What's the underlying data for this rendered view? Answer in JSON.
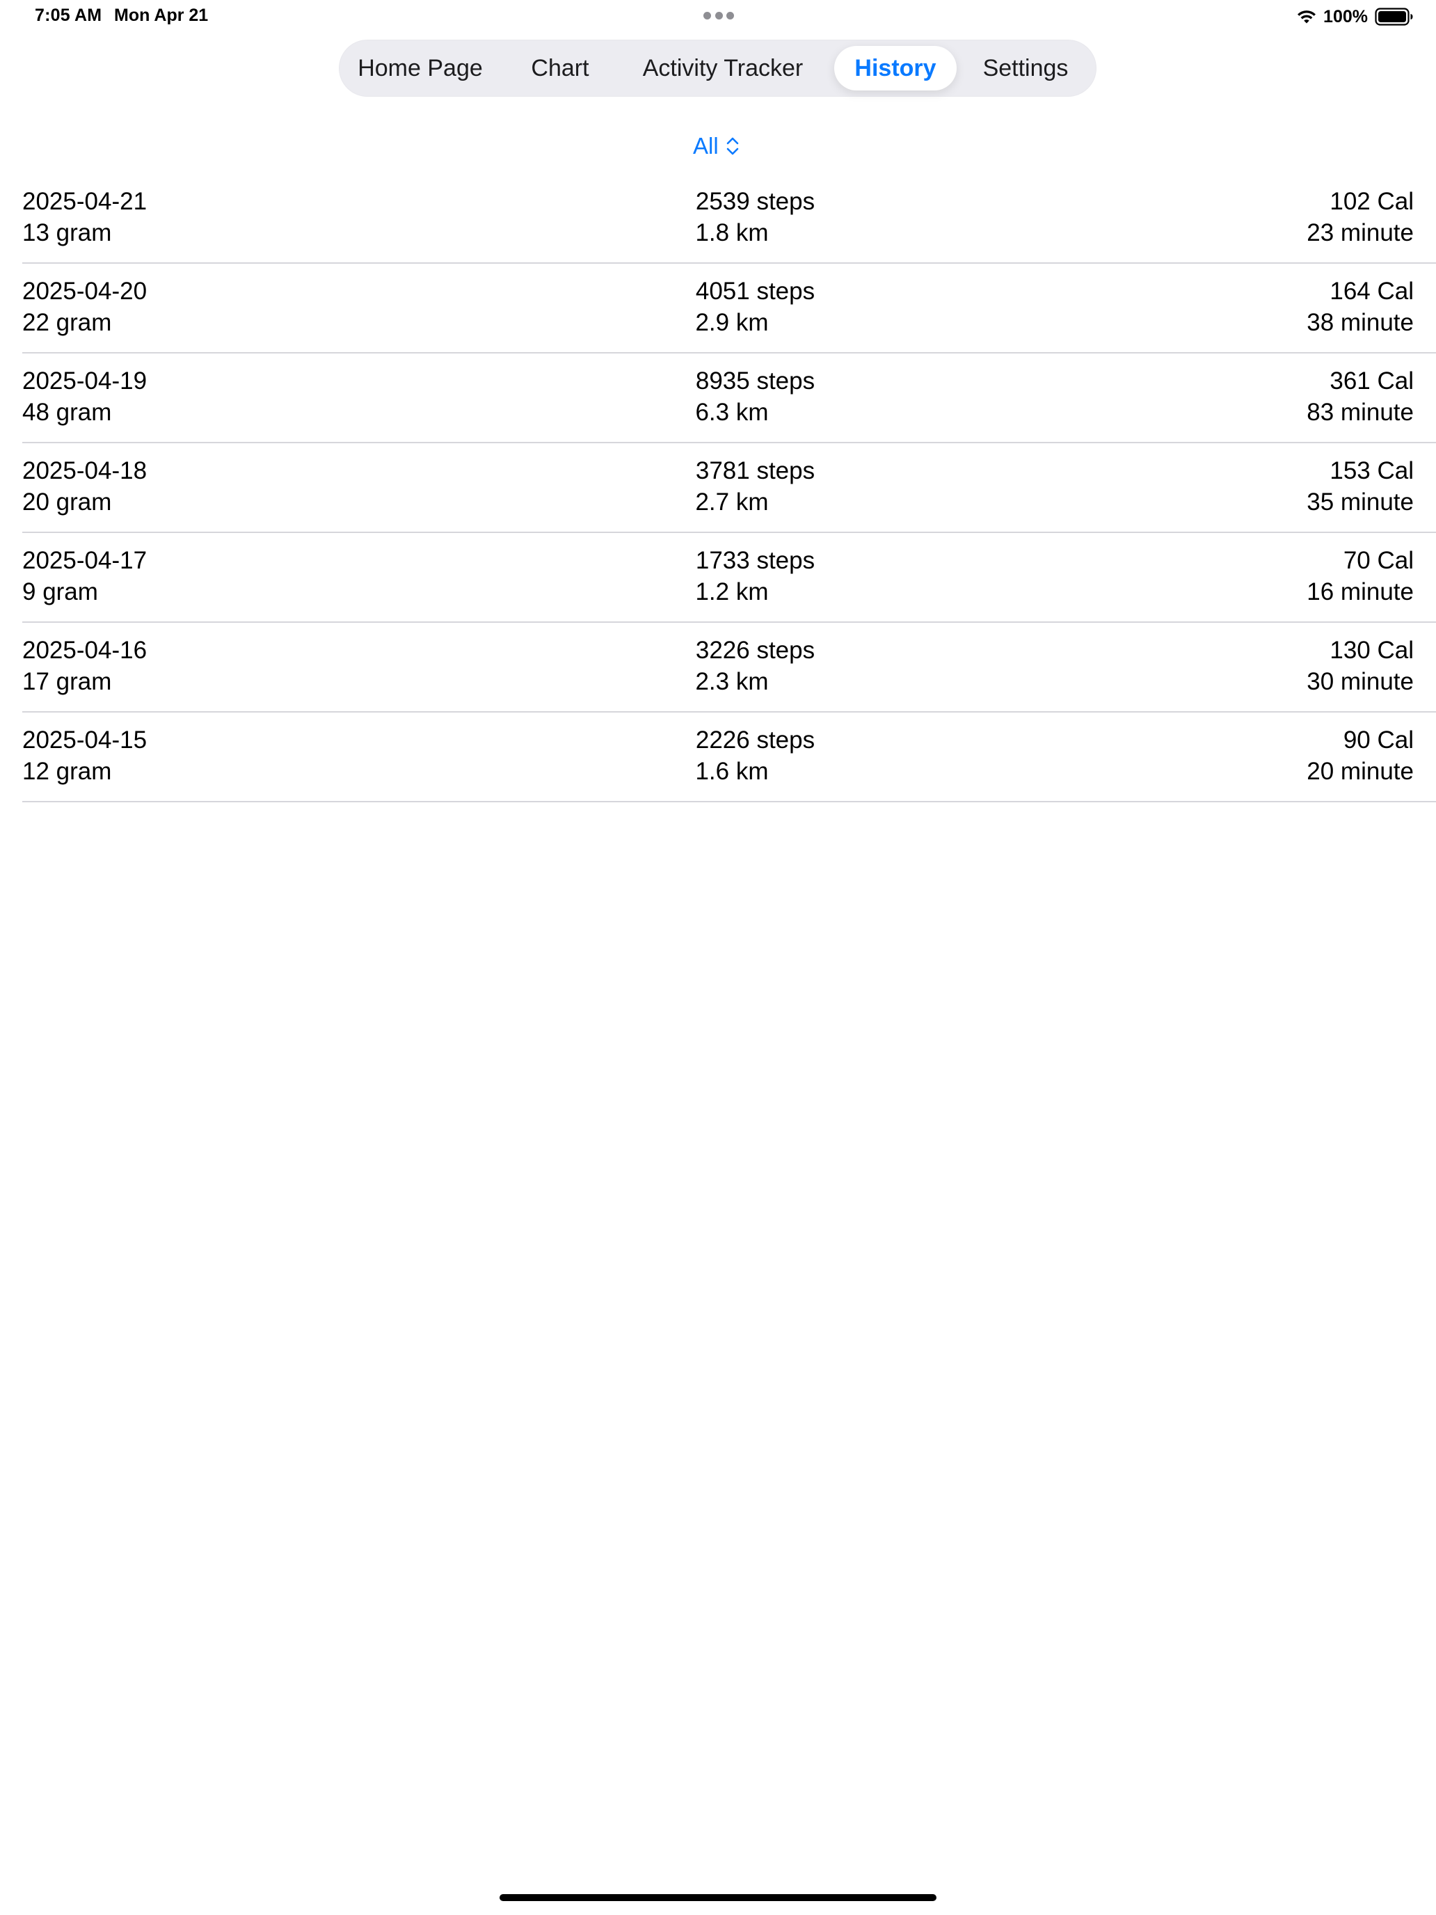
{
  "status_bar": {
    "time": "7:05 AM",
    "date": "Mon Apr 21",
    "battery_percent": "100%"
  },
  "tabs": [
    {
      "label": "Home Page",
      "active": false
    },
    {
      "label": "Chart",
      "active": false
    },
    {
      "label": "Activity Tracker",
      "active": false
    },
    {
      "label": "History",
      "active": true
    },
    {
      "label": "Settings",
      "active": false
    }
  ],
  "filter": {
    "label": "All",
    "icon": "chevron-up-down-icon"
  },
  "colors": {
    "accent": "#0a7aff",
    "tab_bar_bg": "#ececf1",
    "separator": "#d6d6db"
  },
  "history": [
    {
      "date": "2025-04-21",
      "weight": "13 gram",
      "steps": "2539 steps",
      "distance": "1.8 km",
      "calories": "102 Cal",
      "minutes": "23 minute"
    },
    {
      "date": "2025-04-20",
      "weight": "22 gram",
      "steps": "4051 steps",
      "distance": "2.9 km",
      "calories": "164 Cal",
      "minutes": "38 minute"
    },
    {
      "date": "2025-04-19",
      "weight": "48 gram",
      "steps": "8935 steps",
      "distance": "6.3 km",
      "calories": "361 Cal",
      "minutes": "83 minute"
    },
    {
      "date": "2025-04-18",
      "weight": "20 gram",
      "steps": "3781 steps",
      "distance": "2.7 km",
      "calories": "153 Cal",
      "minutes": "35 minute"
    },
    {
      "date": "2025-04-17",
      "weight": "9 gram",
      "steps": "1733 steps",
      "distance": "1.2 km",
      "calories": "70 Cal",
      "minutes": "16 minute"
    },
    {
      "date": "2025-04-16",
      "weight": "17 gram",
      "steps": "3226 steps",
      "distance": "2.3 km",
      "calories": "130 Cal",
      "minutes": "30 minute"
    },
    {
      "date": "2025-04-15",
      "weight": "12 gram",
      "steps": "2226 steps",
      "distance": "1.6 km",
      "calories": "90 Cal",
      "minutes": "20 minute"
    }
  ]
}
